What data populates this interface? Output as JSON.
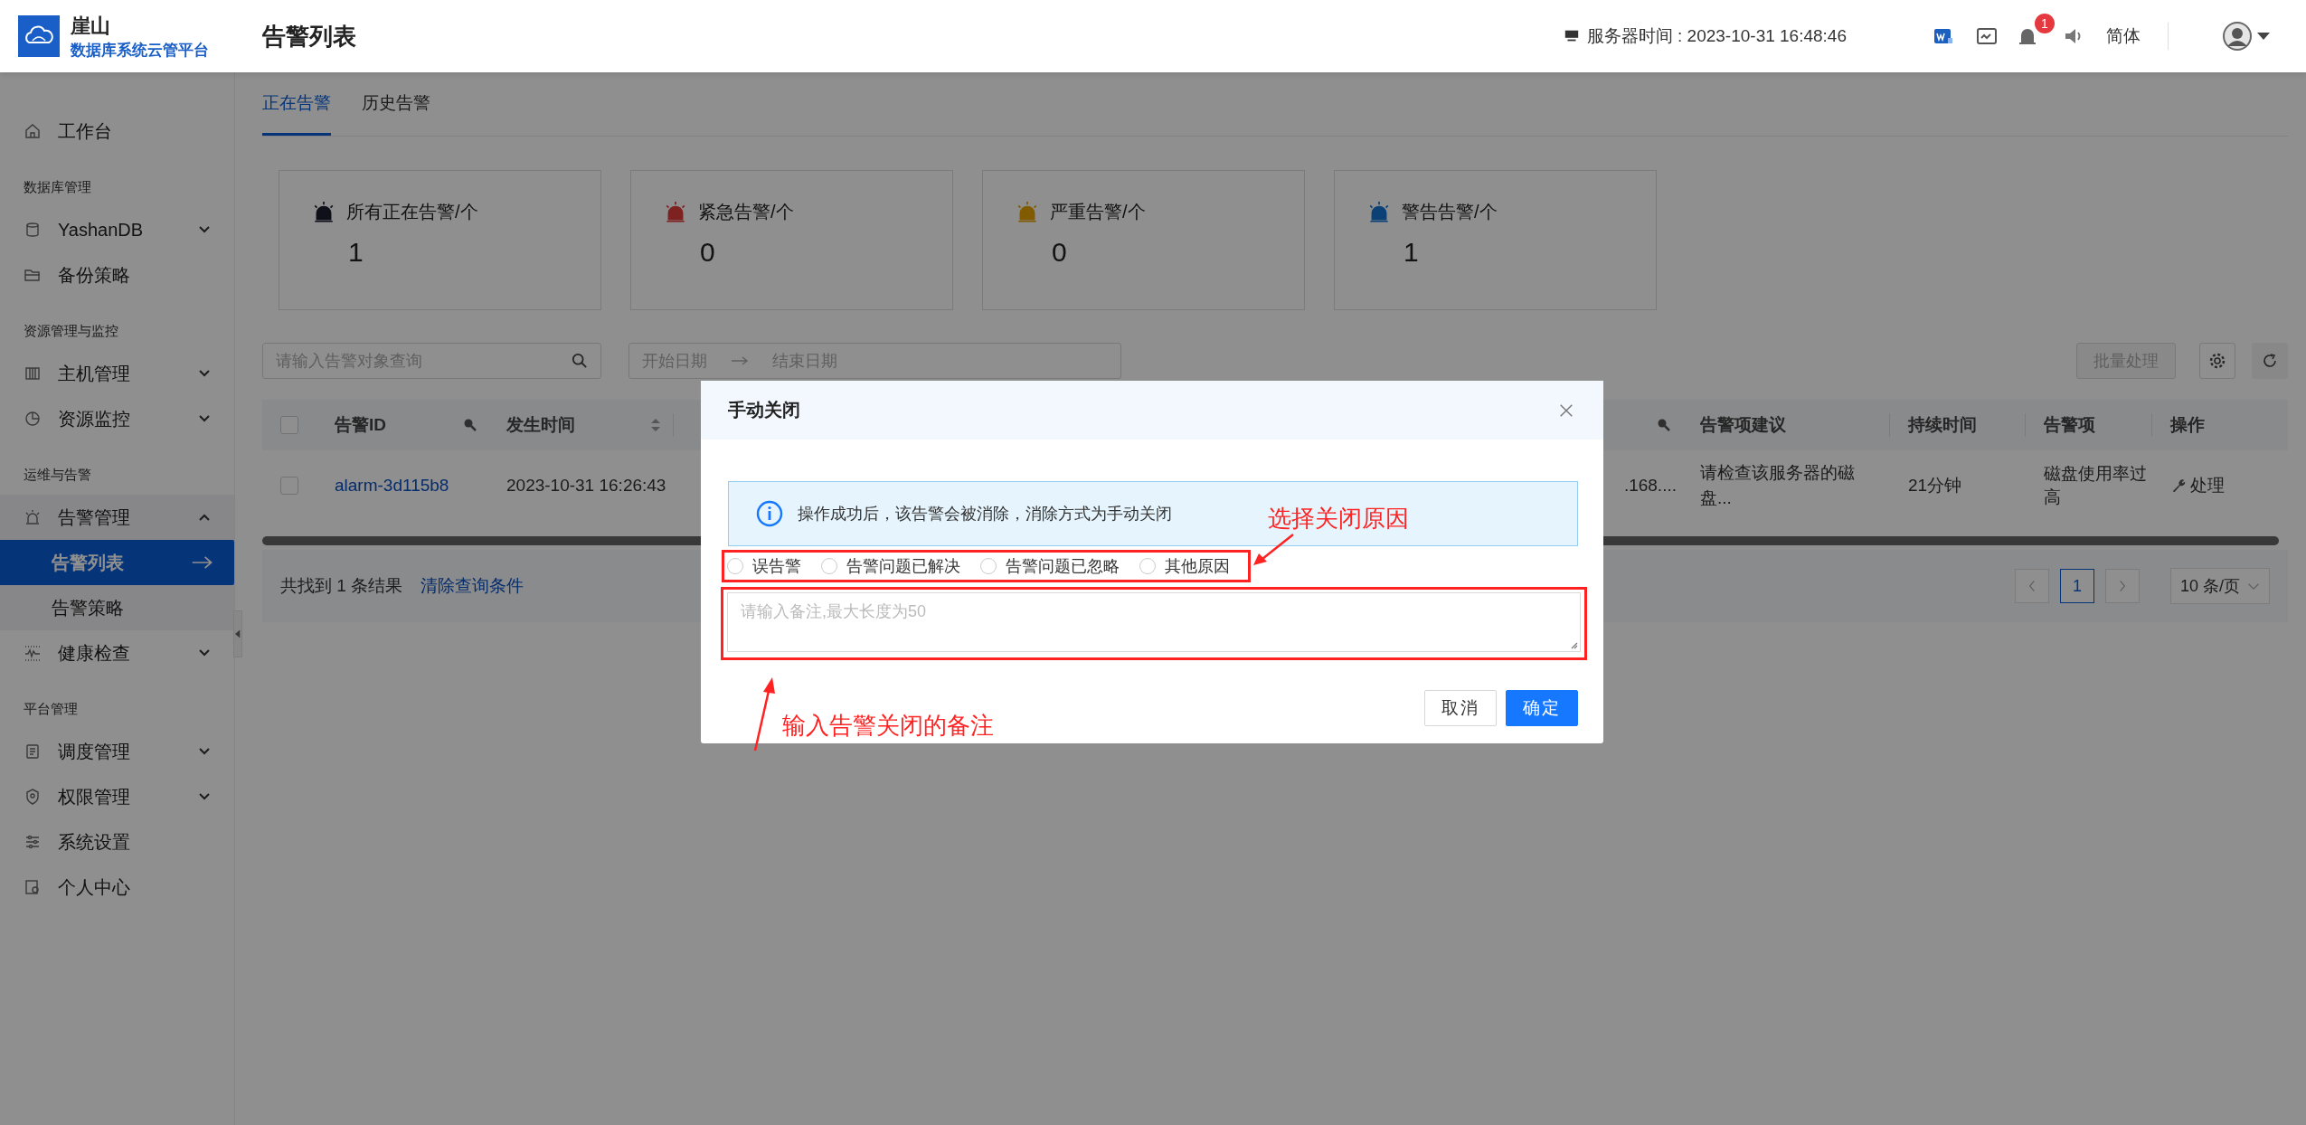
{
  "header": {
    "brand": "崖山",
    "subtitle": "数据库系统云管平台",
    "page_title": "告警列表",
    "server_time": "服务器时间 : 2023-10-31 16:48:46",
    "notification_badge": "1",
    "language": "简体"
  },
  "sidebar": {
    "items": [
      {
        "kind": "link",
        "label": "工作台"
      },
      {
        "kind": "section",
        "label": "数据库管理"
      },
      {
        "kind": "group",
        "label": "YashanDB",
        "expanded": false
      },
      {
        "kind": "link",
        "label": "备份策略"
      },
      {
        "kind": "section",
        "label": "资源管理与监控"
      },
      {
        "kind": "group",
        "label": "主机管理",
        "expanded": false
      },
      {
        "kind": "group",
        "label": "资源监控",
        "expanded": false
      },
      {
        "kind": "section",
        "label": "运维与告警"
      },
      {
        "kind": "group",
        "label": "告警管理",
        "expanded": true,
        "children": [
          {
            "label": "告警列表",
            "selected": true
          },
          {
            "label": "告警策略",
            "selected": false
          }
        ]
      },
      {
        "kind": "group",
        "label": "健康检查",
        "expanded": false
      },
      {
        "kind": "section",
        "label": "平台管理"
      },
      {
        "kind": "group",
        "label": "调度管理",
        "expanded": false
      },
      {
        "kind": "group",
        "label": "权限管理",
        "expanded": false
      },
      {
        "kind": "link",
        "label": "系统设置"
      },
      {
        "kind": "link",
        "label": "个人中心"
      }
    ]
  },
  "tabs": [
    {
      "label": "正在告警",
      "selected": true
    },
    {
      "label": "历史告警",
      "selected": false
    }
  ],
  "stat_cards": [
    {
      "label": "所有正在告警/个",
      "value": "1",
      "color": "#0f111a"
    },
    {
      "label": "紧急告警/个",
      "value": "0",
      "color": "#7e2121"
    },
    {
      "label": "严重告警/个",
      "value": "0",
      "color": "#815b00"
    },
    {
      "label": "警告告警/个",
      "value": "1",
      "color": "#0d4175"
    }
  ],
  "filters": {
    "search_placeholder": "请输入告警对象查询",
    "start_placeholder": "开始日期",
    "end_placeholder": "结束日期",
    "batch_button": "批量处理"
  },
  "table": {
    "all_checked": false,
    "columns": [
      {
        "label": "告警ID",
        "kind": "search"
      },
      {
        "label": "发生时间",
        "kind": "sort"
      },
      {
        "kind": "search"
      },
      {
        "label": "告警项建议",
        "kind": "plain"
      },
      {
        "label": "持续时间",
        "kind": "plain"
      },
      {
        "label": "告警项",
        "kind": "plain"
      },
      {
        "label": "操作",
        "kind": "plain"
      }
    ],
    "rows": [
      {
        "checked": false,
        "cells": [
          "alarm-3d115b8",
          "2023-10-31 16:26:43",
          ".168....",
          "请检查该服务器的磁盘...",
          "21分钟",
          "磁盘使用率过高",
          "处理"
        ]
      }
    ]
  },
  "footer": {
    "result_text": "共找到 1 条结果",
    "clear_link": "清除查询条件",
    "pages": [
      {
        "label": "1",
        "selected": true
      }
    ],
    "page_size": "10 条/页"
  },
  "dialog": {
    "title": "手动关闭",
    "info": "操作成功后，该告警会被消除，消除方式为手动关闭",
    "reasons": [
      {
        "label": "误告警",
        "selected": false
      },
      {
        "label": "告警问题已解决",
        "selected": false
      },
      {
        "label": "告警问题已忽略",
        "selected": false
      },
      {
        "label": "其他原因",
        "selected": false
      }
    ],
    "note_placeholder": "请输入备注,最大长度为50",
    "cancel": "取消",
    "confirm": "确定"
  },
  "annotations": [
    {
      "text": "选择关闭原因"
    },
    {
      "text": "输入告警关闭的备注"
    }
  ]
}
